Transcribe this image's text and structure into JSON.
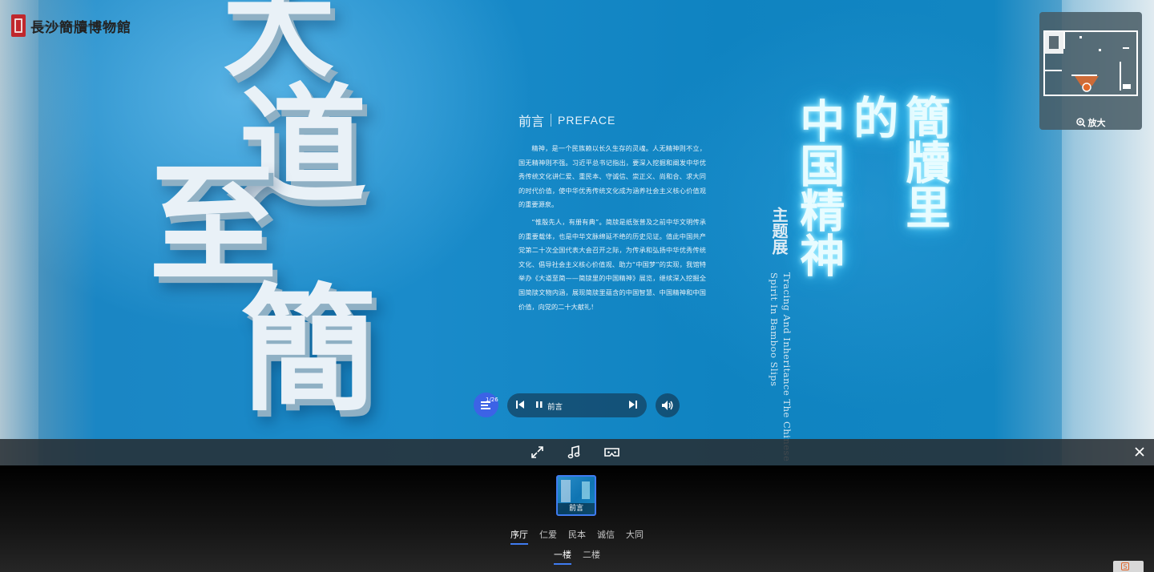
{
  "logo": {
    "text": "長沙簡牘博物館"
  },
  "scene": {
    "big_chars": [
      "大",
      "道",
      "至",
      "簡"
    ],
    "preface": {
      "title_cn": "前言",
      "title_en": "PREFACE",
      "paragraphs": [
        "精神，是一个民族赖以长久生存的灵魂。人无精神则不立，国无精神则不强。习近平总书记指出，要深入挖掘和阐发中华优秀传统文化讲仁爱、重民本、守诚信、崇正义、尚和合、求大同的时代价值，使中华优秀传统文化成为涵养社会主义核心价值观的重要源泉。",
        "“惟殷先人，有册有典”。简牍是纸张普及之前中华文明传承的重要载体，也是中华文脉绵延不绝的历史见证。值此中国共产党第二十次全国代表大会召开之际，为传承和弘扬中华优秀传统文化、倡导社会主义核心价值观、助力“中国梦”的实现，我馆特举办《大道至简——简牍里的中国精神》展览，继续深入挖掘全国简牍文物内涵，展现简牍里蕴含的中国智慧、中国精神和中国价值，向党的二十大献礼！"
      ]
    },
    "title_col1": "簡牘里",
    "title_col2": "的",
    "title_col3": "中国精神",
    "theme": "主题展",
    "theme_en": [
      "Tracing And Inheritance",
      "The Chinese Spirit In Bamboo Slips"
    ]
  },
  "minimap": {
    "zoom_label": "放大",
    "zoom_icon": "zoom-in-icon"
  },
  "player": {
    "count": "1/26",
    "track": "前言",
    "state": "playing"
  },
  "toolbar": {
    "fullscreen_icon": "fullscreen-icon",
    "music_icon": "music-icon",
    "vr_icon": "vr-glasses-icon",
    "close_icon": "close-icon"
  },
  "scene_list": {
    "selected_thumb": "前言",
    "halls": [
      {
        "label": "序厅",
        "active": true
      },
      {
        "label": "仁爱",
        "active": false
      },
      {
        "label": "民本",
        "active": false
      },
      {
        "label": "诚信",
        "active": false
      },
      {
        "label": "大同",
        "active": false
      }
    ],
    "floors": [
      {
        "label": "一楼",
        "active": true
      },
      {
        "label": "二楼",
        "active": false
      }
    ]
  },
  "colors": {
    "accent": "#3f7bf0",
    "scene_blue": "#1a86c4",
    "glow": "#6fe0ff",
    "marker": "#e36b2b"
  }
}
